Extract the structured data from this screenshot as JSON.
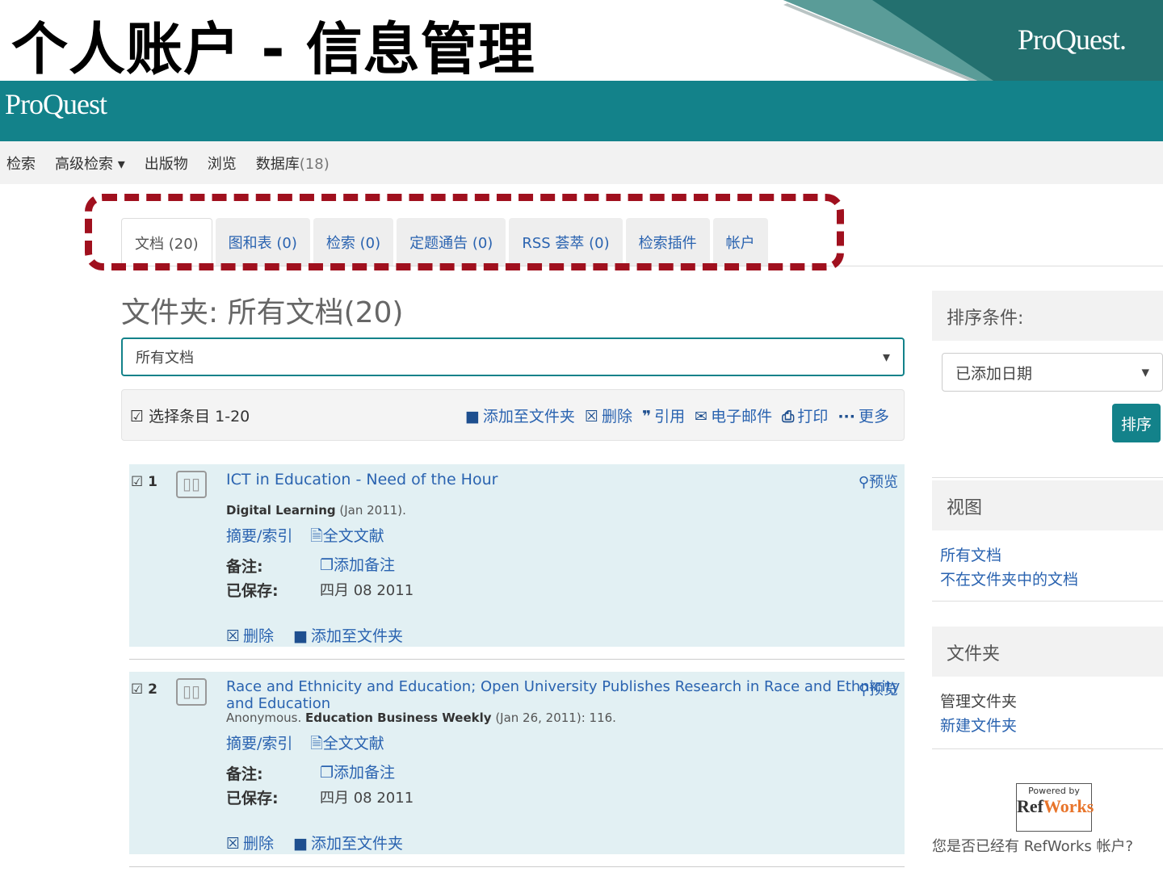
{
  "slide": {
    "title": "个人账户 - 信息管理",
    "logo": "ProQuest."
  },
  "header": {
    "logo": "ProQuest",
    "color": "#13828a"
  },
  "nav": {
    "items": [
      "检索",
      "高级检索 ▾",
      "出版物",
      "浏览"
    ],
    "databases_label": "数据库",
    "databases_count": "(18)"
  },
  "tabs": [
    {
      "label": "文档 (20)",
      "active": true
    },
    {
      "label": "图和表 (0)"
    },
    {
      "label": "检索 (0)"
    },
    {
      "label": "定题通告 (0)"
    },
    {
      "label": "RSS 荟萃 (0)"
    },
    {
      "label": "检索插件"
    },
    {
      "label": "帐户"
    }
  ],
  "folder": {
    "title": "文件夹: 所有文档(20)",
    "select_value": "所有文档"
  },
  "toolbar": {
    "select_label": "选择条目 1-20",
    "add_folder": "添加至文件夹",
    "delete": "删除",
    "cite": "引用",
    "email": "电子邮件",
    "print": "打印",
    "more": "更多"
  },
  "items": [
    {
      "num": "1",
      "title": "ICT in Education - Need of the Hour",
      "preview": "预览",
      "author": "",
      "source": "Digital Learning",
      "date": " (Jan 2011).",
      "abstract": "摘要/索引",
      "fulltext": "全文文献",
      "notes_label": "备注:",
      "add_note": "添加备注",
      "saved_label": "已保存:",
      "saved": "四月 08 2011",
      "delete": "删除",
      "add_folder": "添加至文件夹"
    },
    {
      "num": "2",
      "title": "Race and Ethnicity and Education; Open University Publishes Research in Race and Ethnicity and Education",
      "preview": "预览",
      "author": "Anonymous. ",
      "source": "Education Business Weekly",
      "date": " (Jan 26, 2011): 116.",
      "abstract": "摘要/索引",
      "fulltext": "全文文献",
      "notes_label": "备注:",
      "add_note": "添加备注",
      "saved_label": "已保存:",
      "saved": "四月 08 2011",
      "delete": "删除",
      "add_folder": "添加至文件夹"
    }
  ],
  "sidebar": {
    "sort": {
      "title": "排序条件:",
      "value": "已添加日期",
      "button": "排序"
    },
    "view": {
      "title": "视图",
      "links": [
        "所有文档",
        "不在文件夹中的文档"
      ]
    },
    "folders": {
      "title": "文件夹",
      "manage": "管理文件夹",
      "new": "新建文件夹"
    },
    "refworks": {
      "powered": "Powered by",
      "ref": "Ref",
      "works": "Works",
      "question": "您是否已经有 RefWorks 帐户?"
    }
  },
  "annotation": {
    "color": "#a0101e"
  }
}
